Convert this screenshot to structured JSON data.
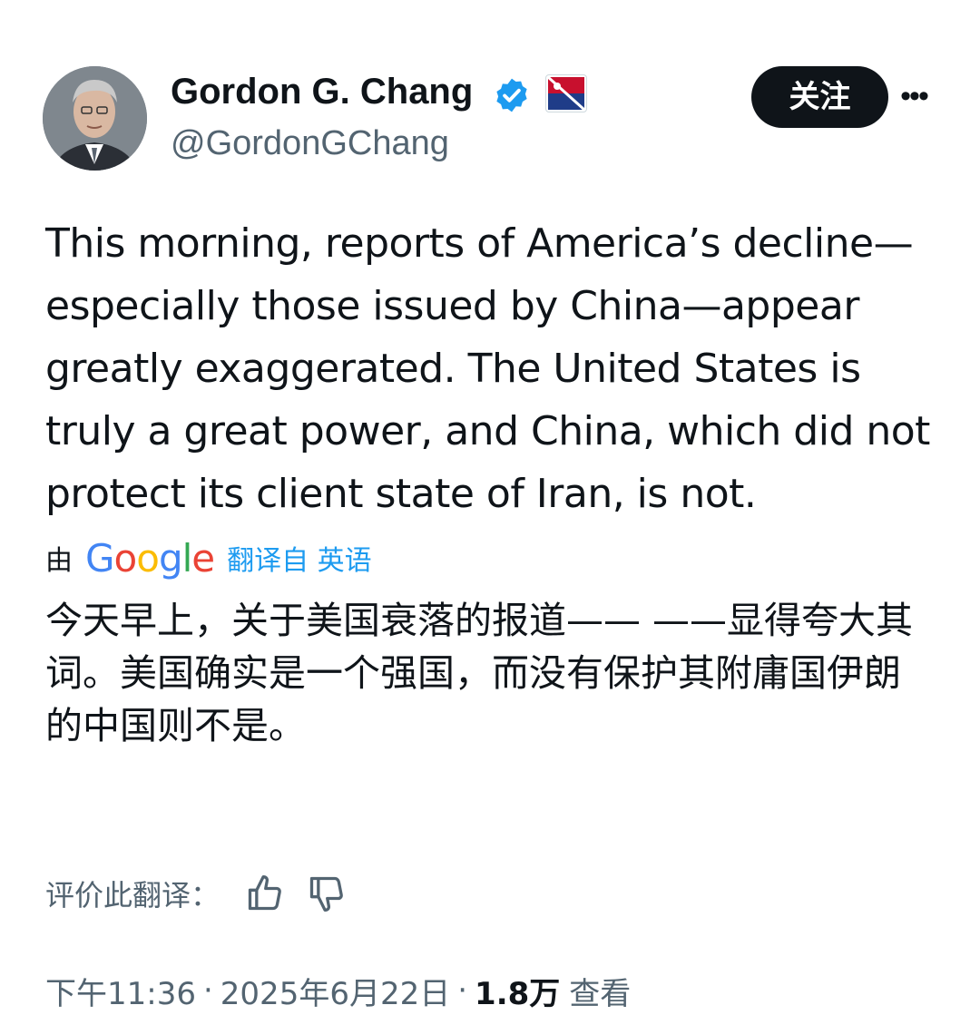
{
  "author": {
    "display_name": "Gordon G. Chang",
    "handle": "@GordonGChang",
    "verified_icon": "verified-badge-icon",
    "affiliation_badge": "CPAC",
    "accent_color": "#1d9bf0"
  },
  "actions": {
    "follow_label": "关注",
    "more_label": "•••"
  },
  "tweet": {
    "text": "This morning, reports of America’s decline—especially those issued by China—appear greatly exaggerated. The United States is truly a great power, and China, which did not protect its client state of Iran, is not."
  },
  "translation": {
    "by_prefix": "由",
    "provider": "Google",
    "link_label": "翻译自 英语",
    "text": "今天早上，关于美国衰落的报道——                    ——显得夸大其词。美国确实是一个强国，而没有保护其附庸国伊朗的中国则不是。"
  },
  "rating": {
    "label": "评价此翻译：",
    "thumbs_up_icon": "thumbs-up-icon",
    "thumbs_down_icon": "thumbs-down-icon"
  },
  "meta": {
    "time": "下午11:36",
    "date": "2025年6月22日",
    "views_count": "1.8万",
    "views_label": "查看"
  }
}
